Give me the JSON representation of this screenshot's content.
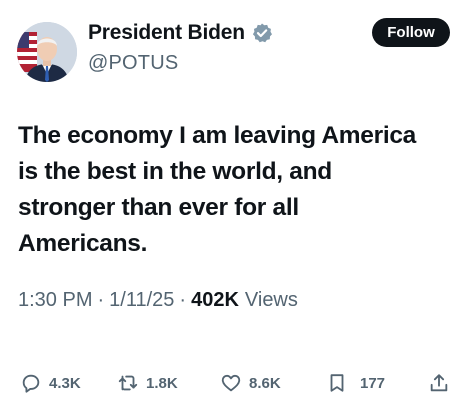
{
  "author": {
    "display_name": "President Biden",
    "handle": "@POTUS",
    "verified": true
  },
  "follow_label": "Follow",
  "tweet": {
    "lines": [
      "The economy I am leaving America",
      "is the best in the world, and",
      "stronger than ever for all",
      "Americans."
    ]
  },
  "meta": {
    "time": "1:30 PM",
    "date": "1/11/25",
    "views_count": "402K",
    "views_label": "Views",
    "separator": "·"
  },
  "actions": {
    "replies": "4.3K",
    "reposts": "1.8K",
    "likes": "8.6K",
    "bookmarks": "177"
  },
  "icons": {
    "verified": "verified-badge-icon",
    "reply": "reply-icon",
    "repost": "repost-icon",
    "like": "heart-icon",
    "bookmark": "bookmark-icon",
    "share": "share-icon"
  },
  "colors": {
    "text": "#0f1419",
    "secondary": "#536471",
    "follow_bg": "#0f1419",
    "verified": "#829aab"
  }
}
